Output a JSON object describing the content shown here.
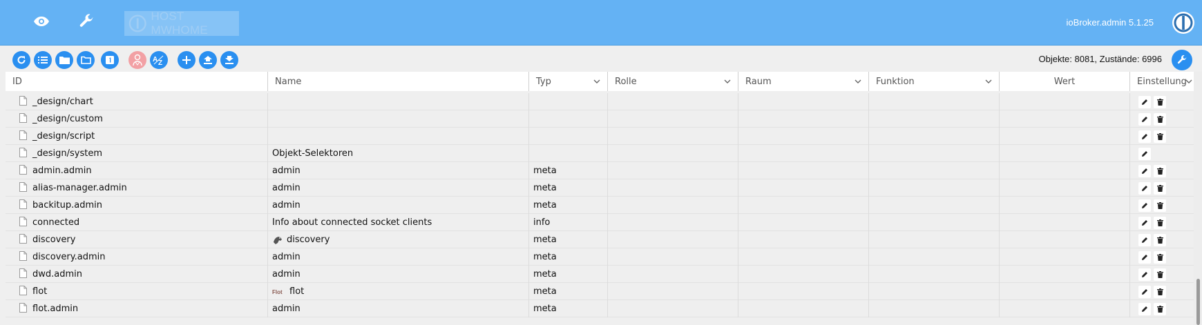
{
  "header": {
    "host_label": "HOST MWHOME",
    "version": "ioBroker.admin 5.1.25",
    "icons": [
      "eye-icon",
      "wrench-icon",
      "iobroker-logo-icon"
    ]
  },
  "toolbar": {
    "buttons": [
      "refresh-icon",
      "list-icon",
      "folder-icon",
      "folder-outline-icon",
      "number-one-icon",
      "expert-mode-icon",
      "sort-az-icon",
      "plus-icon",
      "upload-icon",
      "download-icon"
    ],
    "counts": "Objekte: 8081, Zustände: 6996"
  },
  "columns": {
    "id": "ID",
    "name": "Name",
    "typ": "Typ",
    "rolle": "Rolle",
    "raum": "Raum",
    "funktion": "Funktion",
    "wert": "Wert",
    "einstellungen": "Einstellung"
  },
  "rows": [
    {
      "id": "_design/chart",
      "name": "",
      "type": "",
      "deletable": true
    },
    {
      "id": "_design/custom",
      "name": "",
      "type": "",
      "deletable": true
    },
    {
      "id": "_design/script",
      "name": "",
      "type": "",
      "deletable": true
    },
    {
      "id": "_design/system",
      "name": "Objekt-Selektoren",
      "type": "",
      "deletable": false
    },
    {
      "id": "admin.admin",
      "name": "admin",
      "type": "meta",
      "deletable": true
    },
    {
      "id": "alias-manager.admin",
      "name": "admin",
      "type": "meta",
      "deletable": true
    },
    {
      "id": "backitup.admin",
      "name": "admin",
      "type": "meta",
      "deletable": true
    },
    {
      "id": "connected",
      "name": "Info about connected socket clients",
      "type": "info",
      "deletable": true
    },
    {
      "id": "discovery",
      "name": "discovery",
      "type": "meta",
      "deletable": true,
      "name_icon": "discovery-dog-icon"
    },
    {
      "id": "discovery.admin",
      "name": "admin",
      "type": "meta",
      "deletable": true
    },
    {
      "id": "dwd.admin",
      "name": "admin",
      "type": "meta",
      "deletable": true
    },
    {
      "id": "flot",
      "name": "flot",
      "type": "meta",
      "deletable": true,
      "name_icon": "flot-logo-icon"
    },
    {
      "id": "flot.admin",
      "name": "admin",
      "type": "meta",
      "deletable": true
    }
  ],
  "colors": {
    "header_bg": "#64b2f4",
    "button_bg": "#2a8ff0",
    "button_disabled_bg": "#f2a0a4"
  }
}
